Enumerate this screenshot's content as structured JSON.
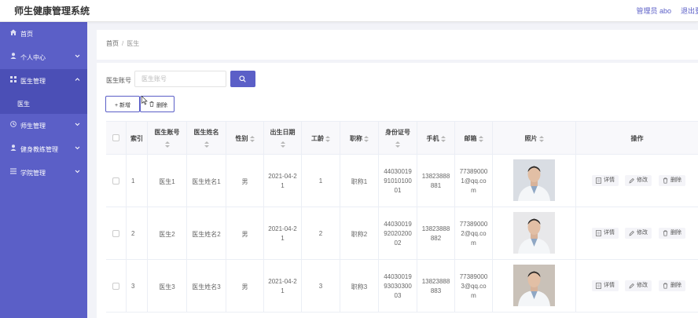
{
  "header": {
    "title": "师生健康管理系统",
    "user": "管理员 abo",
    "logout": "退出登"
  },
  "sidebar": {
    "items": [
      {
        "label": "首页",
        "icon": "home-icon"
      },
      {
        "label": "个人中心",
        "icon": "user-icon"
      },
      {
        "label": "医生管理",
        "icon": "grid-icon",
        "sub": [
          "医生"
        ]
      },
      {
        "label": "师生管理",
        "icon": "clock-icon"
      },
      {
        "label": "健身教练管理",
        "icon": "person-icon"
      },
      {
        "label": "学院管理",
        "icon": "list-icon"
      }
    ]
  },
  "breadcrumb": {
    "home": "首页",
    "sep": "/",
    "current": "医生"
  },
  "search": {
    "label": "医生账号",
    "placeholder": "医生账号"
  },
  "toolbar": {
    "add": "+ 新增",
    "delete": "删除"
  },
  "table": {
    "columns": [
      "索引",
      "医生账号",
      "医生姓名",
      "性别",
      "出生日期",
      "工龄",
      "职称",
      "身份证号",
      "手机",
      "邮箱",
      "照片",
      "操作"
    ],
    "rows": [
      {
        "index": "1",
        "account": "医生1",
        "name": "医生姓名1",
        "gender": "男",
        "dob": [
          "2021-04-2",
          "1"
        ],
        "years": "1",
        "title": "职称1",
        "id_no": [
          "44030019",
          "91010100",
          "01"
        ],
        "phone": [
          "13823888",
          "881"
        ],
        "email": [
          "77389000",
          "1@qq.co",
          "m"
        ]
      },
      {
        "index": "2",
        "account": "医生2",
        "name": "医生姓名2",
        "gender": "男",
        "dob": [
          "2021-04-2",
          "1"
        ],
        "years": "2",
        "title": "职称2",
        "id_no": [
          "44030019",
          "92020200",
          "02"
        ],
        "phone": [
          "13823888",
          "882"
        ],
        "email": [
          "77389000",
          "2@qq.co",
          "m"
        ]
      },
      {
        "index": "3",
        "account": "医生3",
        "name": "医生姓名3",
        "gender": "男",
        "dob": [
          "2021-04-2",
          "1"
        ],
        "years": "3",
        "title": "职称3",
        "id_no": [
          "44030019",
          "93030300",
          "03"
        ],
        "phone": [
          "13823888",
          "883"
        ],
        "email": [
          "77389000",
          "3@qq.co",
          "m"
        ]
      }
    ],
    "actions": {
      "detail": "详情",
      "edit": "修改",
      "delete": "删除"
    }
  },
  "colors": {
    "primary": "#5b5fc7",
    "sidebar_active": "#4b4fb6"
  }
}
